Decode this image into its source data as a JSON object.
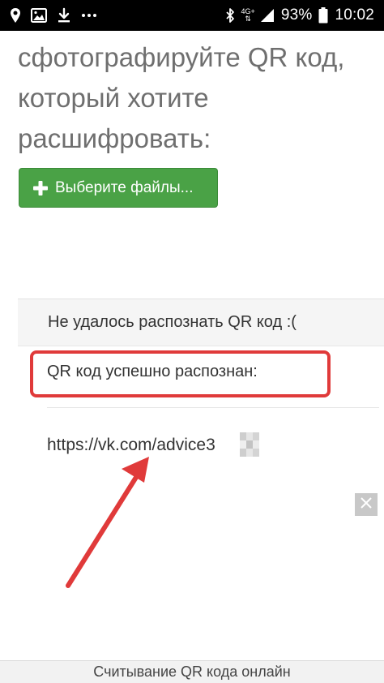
{
  "status_bar": {
    "left_icons": [
      "location-pin-icon",
      "image-icon",
      "download-icon",
      "more-dots-icon"
    ],
    "network_label": "4G+",
    "battery_percent": "93%",
    "time": "10:02",
    "right_icons": [
      "bluetooth-icon",
      "network-4g-icon",
      "signal-icon",
      "battery-icon"
    ]
  },
  "heading": {
    "line1": "сфотографируйте QR код,",
    "line2": "который хотите",
    "line3": "расшифровать:"
  },
  "choose_button": {
    "label": "Выберите файлы...",
    "icon": "plus-icon"
  },
  "results": {
    "fail_text": "Не удалось распознать QR код :(",
    "success_text": "QR код успешно распознан:",
    "url": "https://vk.com/advice3"
  },
  "annotations": {
    "highlight_color": "#e03a3a",
    "arrow_color": "#e03a3a"
  },
  "ad": {
    "close_icon": "close-icon"
  },
  "footer": {
    "title": "Считывание QR кода онлайн"
  },
  "colors": {
    "button_green": "#4aa246",
    "heading_gray": "#6f6f6f",
    "text_dark": "#333333"
  }
}
